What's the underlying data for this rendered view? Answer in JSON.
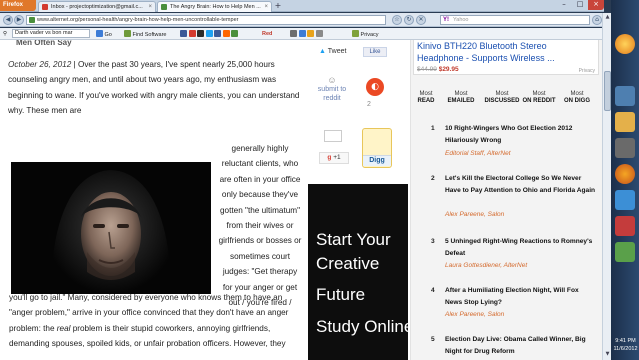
{
  "browser": {
    "app_button": "Firefox",
    "tabs": [
      {
        "label": "Inbox - projectoptimization@gmail.c...",
        "color": "#d33a2f"
      },
      {
        "label": "The Angry Brain: How to Help Men ...",
        "color": "#4a8f3c"
      }
    ],
    "url": "www.alternet.org/personal-health/angry-brain-how-help-men-uncontrollable-temper",
    "search_placeholder": "Yahoo",
    "search_engine_glyph": "Y!"
  },
  "toolbar2": {
    "search_text": "Darth vader vs bon mar",
    "go_label": "Go",
    "find_software_label": "Find Software",
    "red_label": "Red",
    "privacy_label": "Privacy"
  },
  "article": {
    "top_fragment": "Men Often Say",
    "date": "October 26, 2012",
    "para1": "Over the past 30 years, I've spent nearly 25,000 hours counseling angry men, and until about two years ago, my enthusiasm was beginning to wane. If you've worked with angry male clients, you can understand why. These men are",
    "side_text": "generally highly reluctant clients, who are often in your office only because they've gotten \"the ultimatum\" from their wives or girlfriends or bosses or sometimes court judges: \"Get therapy for your anger or get out / you're fired /",
    "para_cont_1": "you'll go to jail.\" Many, considered by everyone who knows them to have an",
    "para_cont_2": "\"anger problem,\" arrive in your office convinced that they don't have an anger",
    "para_cont_3a": "problem: the ",
    "para_cont_3b": "real",
    "para_cont_3c": " problem is their stupid coworkers, annoying girlfriends,",
    "para_cont_4": "demanding spouses, spoiled kids, or unfair probation officers. However, they"
  },
  "social": {
    "tweet_label": "Tweet",
    "like_label": "Like",
    "reddit_label": "submit to reddit",
    "stumble_count": "2",
    "gplus_count": "",
    "gplus_label": "+1",
    "digg_count": "",
    "digg_label": "Digg"
  },
  "ad_left": {
    "lines": [
      "Start Your",
      "Creative",
      "Future",
      "Study Online"
    ]
  },
  "ad_top": {
    "title_line1": "Kinivo BTH220 Bluetooth Stereo",
    "title_line2": "Headphone - Supports Wireless ...",
    "old_price": "$44.99",
    "new_price": "$29.95",
    "privacy": "Privacy"
  },
  "rc_tabs": [
    {
      "up": "Most",
      "label": "READ"
    },
    {
      "up": "Most",
      "label": "EMAILED"
    },
    {
      "up": "Most",
      "label": "DISCUSSED"
    },
    {
      "up": "Most",
      "label": "ON REDDIT"
    },
    {
      "up": "Most",
      "label": "ON DIGG"
    }
  ],
  "rc_items": [
    {
      "num": "1",
      "title": "10 Right-Wingers Who Got Election 2012 Hilariously Wrong",
      "author": "Editorial Staff, AlterNet"
    },
    {
      "num": "2",
      "title": "Let's Kill the Electoral College So We Never Have to Pay Attention to Ohio and Florida Again",
      "author": "Alex Pareene, Salon"
    },
    {
      "num": "3",
      "title": "5 Unhinged Right-Wing Reactions to Romney's Defeat",
      "author": "Laura Gottesdiener, AlterNet"
    },
    {
      "num": "4",
      "title": "After a Humiliating Election Night, Will Fox News Stop Lying?",
      "author": "Alex Pareene, Salon"
    },
    {
      "num": "5",
      "title": "Election Day Live: Obama Called Winner, Big Night for Drug Reform",
      "author": ""
    }
  ],
  "taskbar": {
    "time": "9:41 PM",
    "date": "11/6/2012"
  },
  "colors": {
    "brand_orange": "#e0782a",
    "link_blue": "#1a4fb0",
    "author_orange": "#d46a2d",
    "taskbar": "#1c2f4a"
  }
}
